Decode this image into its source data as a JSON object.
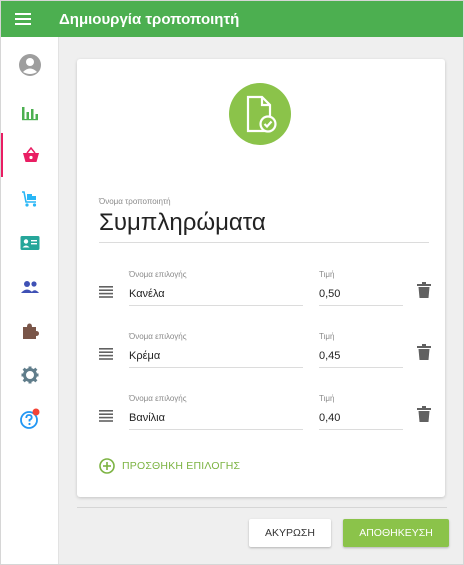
{
  "header": {
    "title": "Δημιουργία τροποποιητή",
    "menu_icon": "menu-icon",
    "color": "#4caf50"
  },
  "sidebar": {
    "items": [
      {
        "name": "account",
        "icon": "account-circle-icon",
        "color": "#9e9e9e",
        "active": false
      },
      {
        "name": "reports",
        "icon": "bar-chart-icon",
        "color": "#4caf50",
        "active": false
      },
      {
        "name": "basket",
        "icon": "basket-icon",
        "color": "#e91e63",
        "active": true
      },
      {
        "name": "delivery",
        "icon": "cart-icon",
        "color": "#29b6f6",
        "active": false
      },
      {
        "name": "contacts",
        "icon": "contact-card-icon",
        "color": "#26a69a",
        "active": false
      },
      {
        "name": "users",
        "icon": "group-icon",
        "color": "#3f51b5",
        "active": false
      },
      {
        "name": "extensions",
        "icon": "puzzle-icon",
        "color": "#795548",
        "active": false
      },
      {
        "name": "settings",
        "icon": "gear-icon",
        "color": "#607d8b",
        "active": false
      },
      {
        "name": "help",
        "icon": "help-icon",
        "color": "#2196f3",
        "active": false,
        "notification_color": "#f44336"
      }
    ]
  },
  "form": {
    "hero_icon": "document-check-icon",
    "hero_color": "#8bc34a",
    "modifier_name_label": "Όνομα τροποποιητή",
    "modifier_name_value": "Συμπληρώματα",
    "option_label": "Όνομα επιλογής",
    "price_label": "Τιμή",
    "options": [
      {
        "name": "Κανέλα",
        "price": "0,50"
      },
      {
        "name": "Κρέμα",
        "price": "0,45"
      },
      {
        "name": "Βανίλια",
        "price": "0,40"
      }
    ],
    "add_option_label": "ΠΡΟΣΘΗΚΗ ΕΠΙΛΟΓΗΣ",
    "accent_color": "#7cb342"
  },
  "actions": {
    "cancel_label": "ΑΚΥΡΩΣΗ",
    "save_label": "ΑΠΟΘΗΚΕΥΣΗ"
  }
}
